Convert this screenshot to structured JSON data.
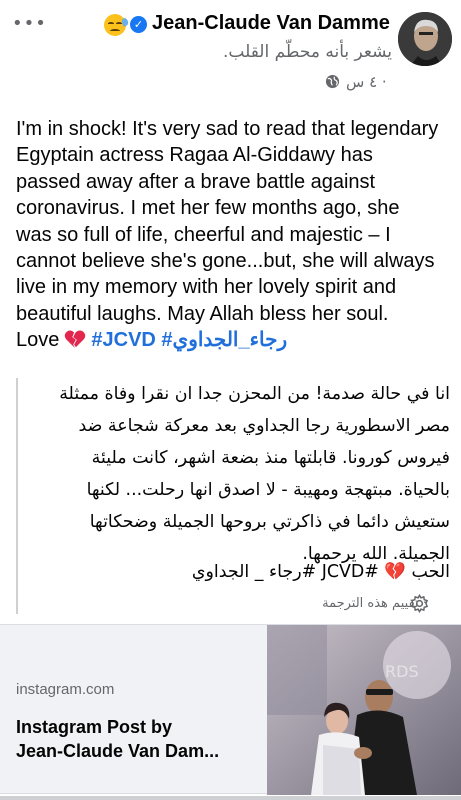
{
  "header": {
    "author_name": "Jean-Claude Van Damme",
    "feeling_text": "يشعر بأنه محطّم القلب.",
    "timestamp": "٤ س ·",
    "icons": [
      "more-options-icon",
      "sad-face-emoji",
      "verified-badge-icon",
      "globe-icon"
    ]
  },
  "post": {
    "lines": [
      "I'm in shock! It's very sad to read that legendary",
      "Egyptain actress Ragaa Al-Giddawy has",
      "passed away after a brave battle against",
      "coronavirus. I met her few months ago, she",
      "was so full of life, cheerful and majestic – I",
      "cannot believe she's gone...but, she will always",
      "live in my memory with her lovely spirit and",
      "beautiful laughs. May Allah bless her soul."
    ],
    "love_word": "Love",
    "hashtag_jcvd": "#JCVD",
    "hashtag_arabic": "#رجاء_الجداوي"
  },
  "translation": {
    "lines": "انا في حالة صدمة! من المحزن جدا ان نقرا وفاة ممثلة\nمصر الاسطورية رجا الجداوي بعد معركة شجاعة ضد\nفيروس كورونا. قابلتها منذ بضعة اشهر، كانت مليئة\nبالحياة. مبتهجة ومهيبة - لا اصدق انها رحلت... لكنها\nستعيش دائما في ذاكرتي بروحها الجميلة وضحكاتها\nالجميلة. الله يرحمها.",
    "last_line": "الحب 💔 #JCVD #رجاء _ الجداوي",
    "rate_label": "· تقييم هذه الترجمة"
  },
  "link_card": {
    "domain": "instagram.com",
    "title_line1": "Instagram Post by",
    "title_line2": "Jean-Claude Van Dam..."
  },
  "colors": {
    "hashtag": "#216fdb",
    "secondary_text": "#65676b",
    "verified": "#1877f2",
    "card_bg": "#f0f2f5",
    "heart": "#e2264d"
  }
}
